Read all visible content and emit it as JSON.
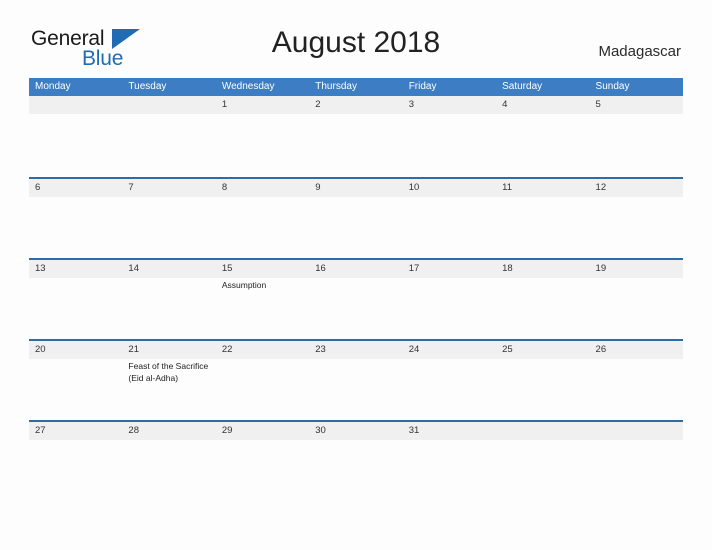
{
  "logo": {
    "text_primary": "General",
    "text_secondary": "Blue",
    "flag_icon": "triangle-flag-icon",
    "color_primary": "#1a1a1a",
    "color_secondary": "#1f6cb4"
  },
  "header": {
    "title": "August 2018",
    "country": "Madagascar"
  },
  "colors": {
    "header_blue": "#3c7dc4",
    "separator_blue": "#2e6da4",
    "band_gray": "#f0f0f0",
    "page_background": "#fdfdfd"
  },
  "calendar": {
    "weekdays": [
      "Monday",
      "Tuesday",
      "Wednesday",
      "Thursday",
      "Friday",
      "Saturday",
      "Sunday"
    ],
    "weeks": [
      {
        "days": [
          {
            "number": "",
            "events": []
          },
          {
            "number": "",
            "events": []
          },
          {
            "number": "1",
            "events": []
          },
          {
            "number": "2",
            "events": []
          },
          {
            "number": "3",
            "events": []
          },
          {
            "number": "4",
            "events": []
          },
          {
            "number": "5",
            "events": []
          }
        ]
      },
      {
        "days": [
          {
            "number": "6",
            "events": []
          },
          {
            "number": "7",
            "events": []
          },
          {
            "number": "8",
            "events": []
          },
          {
            "number": "9",
            "events": []
          },
          {
            "number": "10",
            "events": []
          },
          {
            "number": "11",
            "events": []
          },
          {
            "number": "12",
            "events": []
          }
        ]
      },
      {
        "days": [
          {
            "number": "13",
            "events": []
          },
          {
            "number": "14",
            "events": []
          },
          {
            "number": "15",
            "events": [
              "Assumption"
            ]
          },
          {
            "number": "16",
            "events": []
          },
          {
            "number": "17",
            "events": []
          },
          {
            "number": "18",
            "events": []
          },
          {
            "number": "19",
            "events": []
          }
        ]
      },
      {
        "days": [
          {
            "number": "20",
            "events": []
          },
          {
            "number": "21",
            "events": [
              "Feast of the Sacrifice (Eid al-Adha)"
            ]
          },
          {
            "number": "22",
            "events": []
          },
          {
            "number": "23",
            "events": []
          },
          {
            "number": "24",
            "events": []
          },
          {
            "number": "25",
            "events": []
          },
          {
            "number": "26",
            "events": []
          }
        ]
      },
      {
        "days": [
          {
            "number": "27",
            "events": []
          },
          {
            "number": "28",
            "events": []
          },
          {
            "number": "29",
            "events": []
          },
          {
            "number": "30",
            "events": []
          },
          {
            "number": "31",
            "events": []
          },
          {
            "number": "",
            "events": []
          },
          {
            "number": "",
            "events": []
          }
        ]
      }
    ]
  }
}
